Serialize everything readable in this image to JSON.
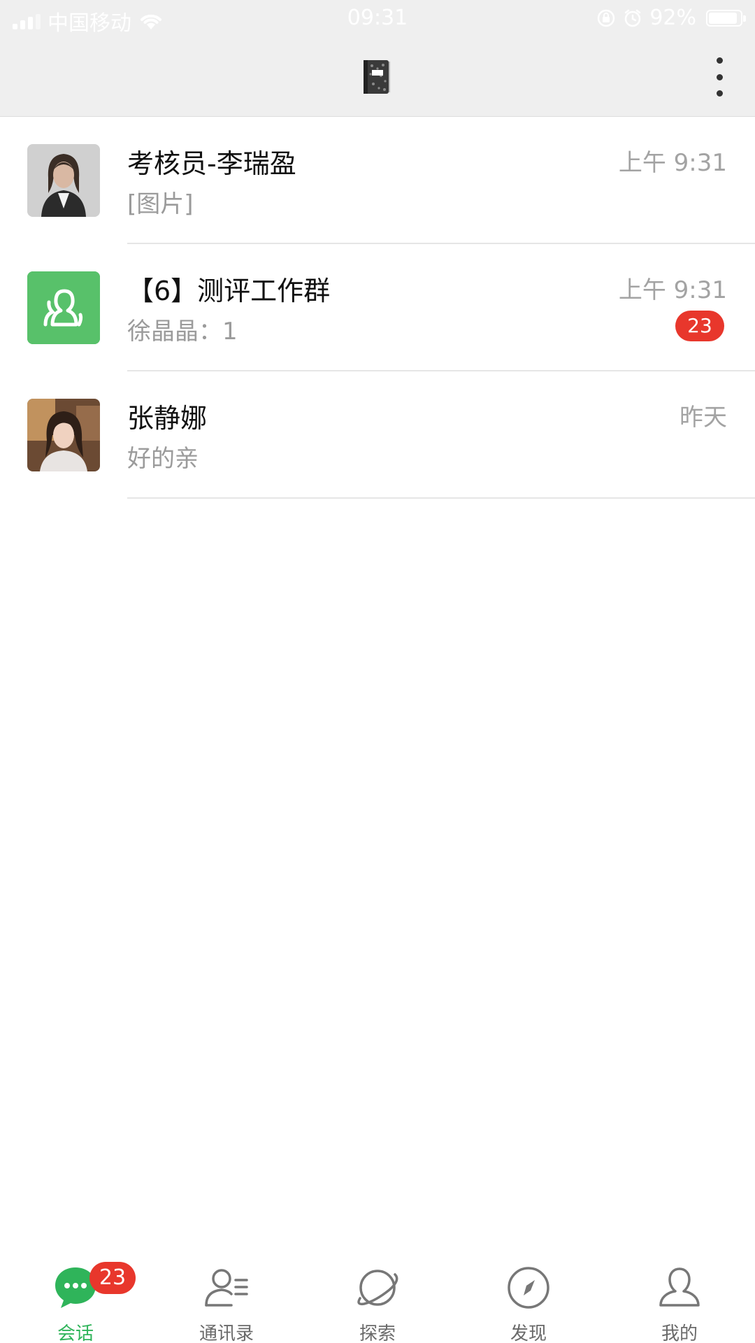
{
  "status_bar": {
    "carrier": "中国移动",
    "time": "09:31",
    "battery_percent_label": "92%",
    "battery_level": 0.92
  },
  "header": {
    "logo_icon": "notebook-icon",
    "menu_icon": "more-vertical-icon"
  },
  "conversations": [
    {
      "title": "考核员-李瑞盈",
      "preview": "[图片]",
      "time": "上午 9:31",
      "badge": "",
      "avatar": "person-photo-avatar"
    },
    {
      "title": "【6】测评工作群",
      "preview": "徐晶晶：1",
      "time": "上午 9:31",
      "badge": "23",
      "avatar": "group-avatar"
    },
    {
      "title": "张静娜",
      "preview": "好的亲",
      "time": "昨天",
      "badge": "",
      "avatar": "person-photo-avatar"
    }
  ],
  "tabs": [
    {
      "label": "会话",
      "icon": "chat-bubble-icon",
      "badge": "23",
      "active": true
    },
    {
      "label": "通讯录",
      "icon": "contacts-icon",
      "badge": "",
      "active": false
    },
    {
      "label": "探索",
      "icon": "planet-icon",
      "badge": "",
      "active": false
    },
    {
      "label": "发现",
      "icon": "compass-icon",
      "badge": "",
      "active": false
    },
    {
      "label": "我的",
      "icon": "person-icon",
      "badge": "",
      "active": false
    }
  ],
  "colors": {
    "accent_green": "#2fb45a",
    "badge_red": "#e8372c",
    "header_bg": "#efefef",
    "group_avatar_green": "#58c16a"
  }
}
